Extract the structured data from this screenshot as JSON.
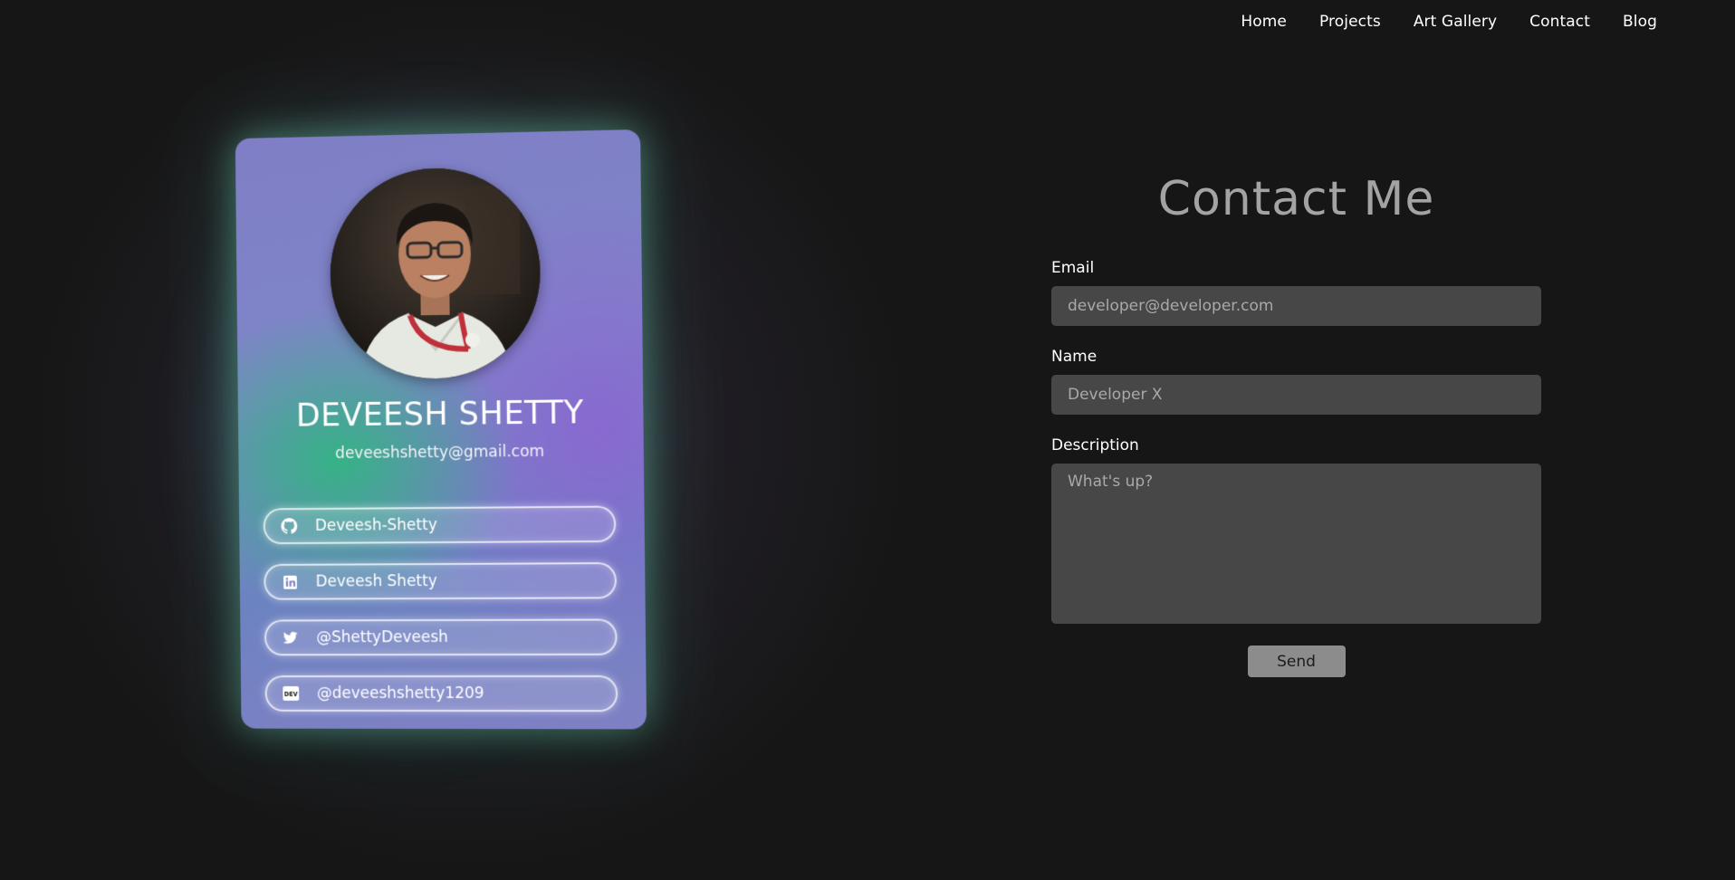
{
  "nav": {
    "items": [
      {
        "label": "Home"
      },
      {
        "label": "Projects"
      },
      {
        "label": "Art Gallery"
      },
      {
        "label": "Contact"
      },
      {
        "label": "Blog"
      }
    ]
  },
  "card": {
    "name": "DEVEESH SHETTY",
    "email": "deveeshshetty@gmail.com",
    "socials": [
      {
        "icon": "github-icon",
        "label": "Deveesh-Shetty"
      },
      {
        "icon": "linkedin-icon",
        "label": "Deveesh Shetty"
      },
      {
        "icon": "twitter-icon",
        "label": "@ShettyDeveesh"
      },
      {
        "icon": "dev-icon",
        "label": "@deveeshshetty1209",
        "icon_text": "DEV"
      }
    ]
  },
  "contact": {
    "title": "Contact Me",
    "email_label": "Email",
    "email_placeholder": "developer@developer.com",
    "name_label": "Name",
    "name_placeholder": "Developer X",
    "description_label": "Description",
    "description_placeholder": "What's up?",
    "send_label": "Send"
  },
  "colors": {
    "background": "#161616",
    "input_bg": "#474747",
    "button_bg": "#8c8c8c",
    "title_color": "#a3a3a3",
    "card_green": "#32b482",
    "card_purple": "#8c64d2"
  }
}
